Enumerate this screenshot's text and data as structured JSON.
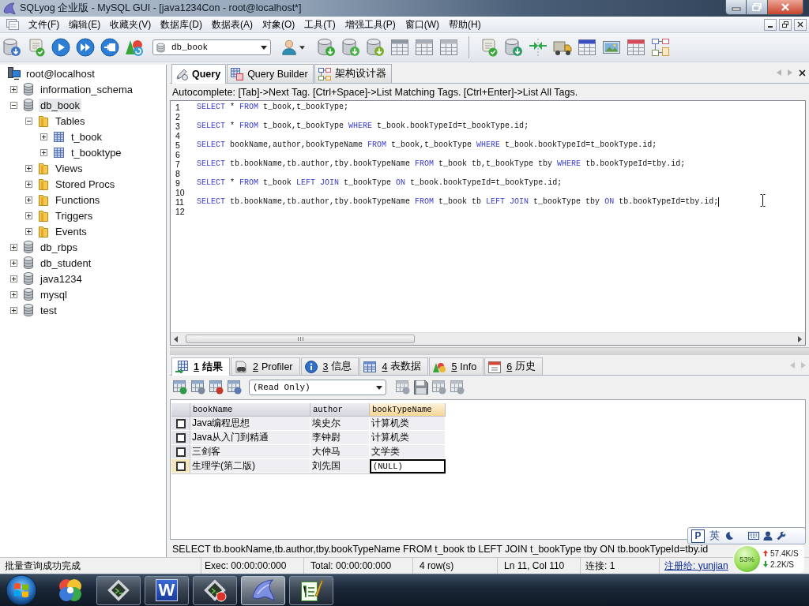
{
  "window": {
    "title": "SQLyog 企业版 - MySQL GUI - [java1234Con - root@localhost*]"
  },
  "menu": [
    "文件(F)",
    "编辑(E)",
    "收藏夹(V)",
    "数据库(D)",
    "数据表(A)",
    "对象(O)",
    "工具(T)",
    "增强工具(P)",
    "窗口(W)",
    "帮助(H)"
  ],
  "toolbar": {
    "database": "db_book"
  },
  "object_tree": [
    {
      "label": "root@localhost",
      "kind": "server",
      "selected": false,
      "children": [
        {
          "label": "information_schema",
          "kind": "database",
          "expanded": false,
          "selected": false
        },
        {
          "label": "db_book",
          "kind": "database",
          "expanded": true,
          "selected": true,
          "children": [
            {
              "label": "Tables",
              "kind": "folder",
              "expanded": true,
              "selected": false,
              "children": [
                {
                  "label": "t_book",
                  "kind": "table",
                  "expanded": false,
                  "selected": false
                },
                {
                  "label": "t_booktype",
                  "kind": "table",
                  "expanded": false,
                  "selected": false
                }
              ]
            },
            {
              "label": "Views",
              "kind": "folder",
              "expanded": false,
              "selected": false
            },
            {
              "label": "Stored Procs",
              "kind": "folder",
              "expanded": false,
              "selected": false
            },
            {
              "label": "Functions",
              "kind": "folder",
              "expanded": false,
              "selected": false
            },
            {
              "label": "Triggers",
              "kind": "folder",
              "expanded": false,
              "selected": false
            },
            {
              "label": "Events",
              "kind": "folder",
              "expanded": false,
              "selected": false
            }
          ]
        },
        {
          "label": "db_rbps",
          "kind": "database",
          "expanded": false,
          "selected": false
        },
        {
          "label": "db_student",
          "kind": "database",
          "expanded": false,
          "selected": false
        },
        {
          "label": "java1234",
          "kind": "database",
          "expanded": false,
          "selected": false
        },
        {
          "label": "mysql",
          "kind": "database",
          "expanded": false,
          "selected": false
        },
        {
          "label": "test",
          "kind": "database",
          "expanded": false,
          "selected": false
        }
      ]
    }
  ],
  "query_tabs": [
    {
      "label": "Query",
      "kind": "query",
      "selected": true
    },
    {
      "label": "Query Builder",
      "kind": "builder",
      "selected": false
    },
    {
      "label": "架构设计器",
      "kind": "schema",
      "selected": false
    }
  ],
  "autocomplete_hint": "Autocomplete: [Tab]->Next Tag. [Ctrl+Space]->List Matching Tags. [Ctrl+Enter]->List All Tags.",
  "editor": {
    "lines": [
      {
        "number": "1",
        "caret": false,
        "tokens": [
          {
            "kind": "keyword",
            "text": "SELECT"
          },
          {
            "kind": "plain",
            "text": " * "
          },
          {
            "kind": "keyword",
            "text": "FROM"
          },
          {
            "kind": "plain",
            "text": " t_book,t_bookType;"
          }
        ]
      },
      {
        "number": "2",
        "caret": false
      },
      {
        "number": "3",
        "caret": false,
        "tokens": [
          {
            "kind": "keyword",
            "text": "SELECT"
          },
          {
            "kind": "plain",
            "text": " * "
          },
          {
            "kind": "keyword",
            "text": "FROM"
          },
          {
            "kind": "plain",
            "text": " t_book,t_bookType "
          },
          {
            "kind": "keyword",
            "text": "WHERE"
          },
          {
            "kind": "plain",
            "text": " t_book.bookTypeId=t_bookType.id;"
          }
        ]
      },
      {
        "number": "4",
        "caret": false
      },
      {
        "number": "5",
        "caret": false,
        "tokens": [
          {
            "kind": "keyword",
            "text": "SELECT"
          },
          {
            "kind": "plain",
            "text": " bookName,author,bookTypeName "
          },
          {
            "kind": "keyword",
            "text": "FROM"
          },
          {
            "kind": "plain",
            "text": " t_book,t_bookType "
          },
          {
            "kind": "keyword",
            "text": "WHERE"
          },
          {
            "kind": "plain",
            "text": " t_book.bookTypeId=t_bookType.id;"
          }
        ]
      },
      {
        "number": "6",
        "caret": false
      },
      {
        "number": "7",
        "caret": false,
        "tokens": [
          {
            "kind": "keyword",
            "text": "SELECT"
          },
          {
            "kind": "plain",
            "text": " tb.bookName,tb.author,tby.bookTypeName "
          },
          {
            "kind": "keyword",
            "text": "FROM"
          },
          {
            "kind": "plain",
            "text": " t_book tb,t_bookType tby "
          },
          {
            "kind": "keyword",
            "text": "WHERE"
          },
          {
            "kind": "plain",
            "text": " tb.bookTypeId=tby.id;"
          }
        ]
      },
      {
        "number": "8",
        "caret": false
      },
      {
        "number": "9",
        "caret": false,
        "tokens": [
          {
            "kind": "keyword",
            "text": "SELECT"
          },
          {
            "kind": "plain",
            "text": " * "
          },
          {
            "kind": "keyword",
            "text": "FROM"
          },
          {
            "kind": "plain",
            "text": " t_book "
          },
          {
            "kind": "keyword",
            "text": "LEFT JOIN"
          },
          {
            "kind": "plain",
            "text": " t_bookType "
          },
          {
            "kind": "keyword",
            "text": "ON"
          },
          {
            "kind": "plain",
            "text": " t_book.bookTypeId=t_bookType.id;"
          }
        ]
      },
      {
        "number": "10",
        "caret": false
      },
      {
        "number": "11",
        "caret": true,
        "tokens": [
          {
            "kind": "keyword",
            "text": "SELECT"
          },
          {
            "kind": "plain",
            "text": " tb.bookName,tb.author,tby.bookTypeName "
          },
          {
            "kind": "keyword",
            "text": "FROM"
          },
          {
            "kind": "plain",
            "text": " t_book tb "
          },
          {
            "kind": "keyword",
            "text": "LEFT JOIN"
          },
          {
            "kind": "plain",
            "text": " t_bookType tby "
          },
          {
            "kind": "keyword",
            "text": "ON"
          },
          {
            "kind": "plain",
            "text": " tb.bookTypeId=tby.id;"
          }
        ]
      },
      {
        "number": "12",
        "caret": false
      }
    ]
  },
  "result_tabs": [
    {
      "key": "1",
      "label": "结果",
      "kind": "result",
      "selected": true
    },
    {
      "key": "2",
      "label": "Profiler",
      "kind": "profiler",
      "selected": false
    },
    {
      "key": "3",
      "label": "信息",
      "kind": "info",
      "selected": false
    },
    {
      "key": "4",
      "label": "表数据",
      "kind": "table",
      "selected": false
    },
    {
      "key": "5",
      "label": "Info",
      "kind": "shapes",
      "selected": false
    },
    {
      "key": "6",
      "label": "历史",
      "kind": "history",
      "selected": false
    }
  ],
  "result_toolbar": {
    "mode": "(Read Only)"
  },
  "result_grid": {
    "columns": [
      {
        "name": "bookName",
        "selected": false
      },
      {
        "name": "author",
        "selected": false
      },
      {
        "name": "bookTypeName",
        "selected": true
      }
    ],
    "rows": [
      {
        "checked": false,
        "selected": false,
        "cells": [
          {
            "text": "Java编程思想",
            "focused": false
          },
          {
            "text": "埃史尔",
            "focused": false
          },
          {
            "text": "计算机类",
            "focused": false
          }
        ]
      },
      {
        "checked": false,
        "selected": false,
        "cells": [
          {
            "text": "Java从入门到精通",
            "focused": false
          },
          {
            "text": "李钟尉",
            "focused": false
          },
          {
            "text": "计算机类",
            "focused": false
          }
        ]
      },
      {
        "checked": false,
        "selected": false,
        "cells": [
          {
            "text": "三剑客",
            "focused": false
          },
          {
            "text": "大仲马",
            "focused": false
          },
          {
            "text": "文学类",
            "focused": false
          }
        ]
      },
      {
        "checked": false,
        "selected": true,
        "cells": [
          {
            "text": "生理学(第二版)",
            "focused": false
          },
          {
            "text": "刘先国",
            "focused": false
          },
          {
            "text": "(NULL)",
            "focused": true
          }
        ]
      }
    ]
  },
  "sql_status": "SELECT tb.bookName,tb.author,tby.bookTypeName FROM t_book tb LEFT JOIN t_bookType tby ON tb.bookTypeId=tby.id",
  "status_bar": {
    "message": "批量查询成功完成",
    "exec": "Exec: 00:00:00:000",
    "total": "Total: 00:00:00:000",
    "rows": "4 row(s)",
    "position": "Ln 11, Col 110",
    "connections": "连接: 1",
    "registered": "注册给: yunjian"
  },
  "taskbar": {
    "apps": [
      {
        "kind": "pinwheel",
        "running": false,
        "active": false
      },
      {
        "kind": "terminal",
        "running": true,
        "active": false
      },
      {
        "kind": "document",
        "glyph": "W",
        "running": true,
        "active": false
      },
      {
        "kind": "terminal-record",
        "running": true,
        "active": false
      },
      {
        "kind": "dolphin",
        "running": true,
        "active": true
      },
      {
        "kind": "notepad",
        "running": true,
        "active": false
      }
    ]
  },
  "ime_bar": {
    "mode": "P",
    "language": "英"
  },
  "network_meter": {
    "percent": "53%",
    "upload": "57.4K/S",
    "download": "2.2K/S"
  }
}
